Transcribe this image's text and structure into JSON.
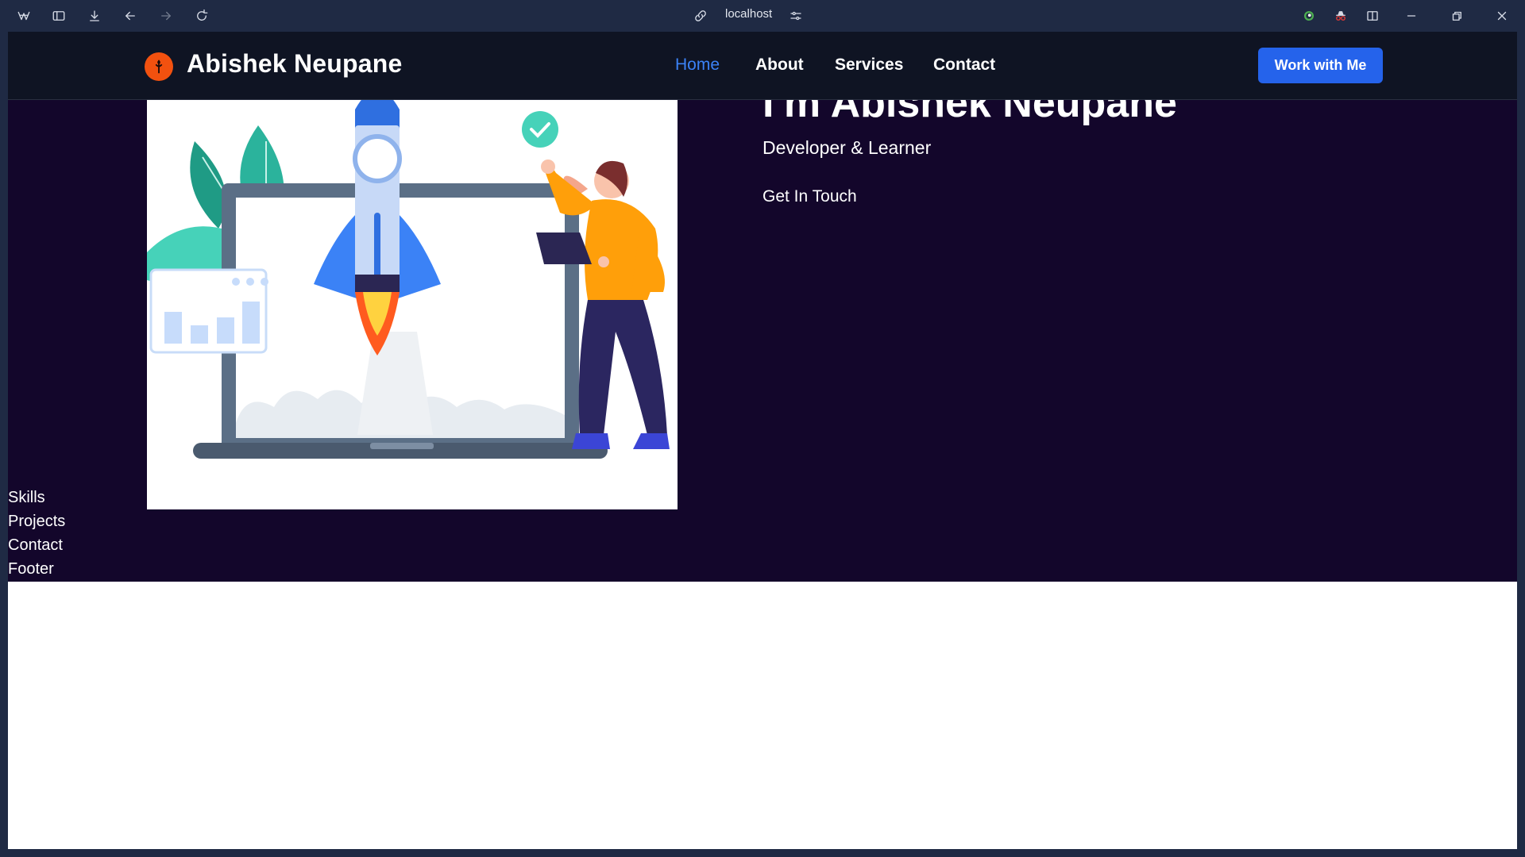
{
  "browser": {
    "url": "localhost",
    "icons": [
      "app-logo-icon",
      "sidebar-toggle-icon",
      "download-icon",
      "back-icon",
      "forward-icon",
      "reload-icon",
      "link-icon",
      "site-settings-icon",
      "extension-icon",
      "incognito-icon",
      "split-view-icon",
      "minimize-icon",
      "restore-icon",
      "close-icon"
    ]
  },
  "site": {
    "brand": "Abishek Neupane",
    "nav": [
      {
        "label": "Home",
        "active": true
      },
      {
        "label": "About",
        "active": false
      },
      {
        "label": "Services",
        "active": false
      },
      {
        "label": "Contact",
        "active": false
      }
    ],
    "cta": "Work with Me"
  },
  "hero": {
    "title": "I'm Abishek Neupane",
    "subtitle": "Developer & Learner",
    "cta": "Get In Touch",
    "illustration": "rocket-launch-illustration"
  },
  "sections": [
    "Skills",
    "Projects",
    "Contact",
    "Footer"
  ],
  "colors": {
    "hero_bg": "#13062b",
    "nav_bg": "#0f1423",
    "accent": "#2563eb",
    "active_link": "#3b82f6",
    "logo": "#f2510f"
  }
}
